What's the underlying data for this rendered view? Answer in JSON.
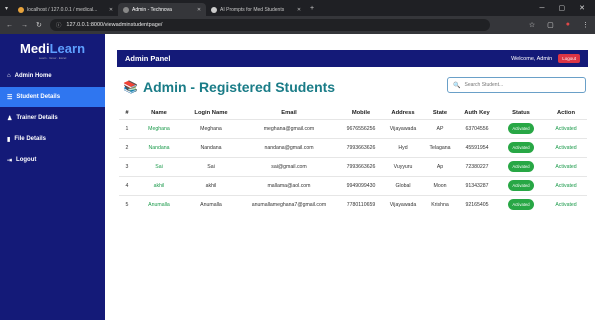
{
  "browser": {
    "tabs": [
      {
        "label": "localhost / 127.0.0.1 / medical...",
        "active": false,
        "color": "#e8a33c"
      },
      {
        "label": "Admin - Technova",
        "active": true,
        "color": "#888888"
      },
      {
        "label": "AI Prompts for Med Students",
        "active": false,
        "color": "#cccccc"
      }
    ],
    "new_tab": "+",
    "url": "127.0.0.1:8000/viewadminstudentpage/"
  },
  "sidebar": {
    "logo_part1": "Medi",
    "logo_part2": "Learn",
    "logo_tagline": "Learn · Grow · Excel",
    "items": [
      {
        "label": "Admin Home",
        "icon": "home-icon"
      },
      {
        "label": "Student Details",
        "icon": "list-icon"
      },
      {
        "label": "Trainer Details",
        "icon": "user-icon"
      },
      {
        "label": "File Details",
        "icon": "file-icon"
      },
      {
        "label": "Logout",
        "icon": "logout-icon"
      }
    ]
  },
  "topbar": {
    "title": "Admin Panel",
    "welcome": "Welcome, Admin",
    "logout": "Logout"
  },
  "page": {
    "heading": "Admin - Registered Students",
    "search_placeholder": "Search Student..."
  },
  "table": {
    "headers": [
      "#",
      "Name",
      "Login Name",
      "Email",
      "Mobile",
      "Address",
      "State",
      "Auth Key",
      "Status",
      "Action"
    ],
    "rows": [
      {
        "num": "1",
        "name": "Meghana",
        "login": "Meghana",
        "email": "meghana@gmail.com",
        "mobile": "9676556256",
        "address": "Vijayawada",
        "state": "AP",
        "authkey": "63704556",
        "status": "Activated",
        "action": "Activated"
      },
      {
        "num": "2",
        "name": "Nandana",
        "login": "Nandana",
        "email": "nandana@gmail.com",
        "mobile": "7993663626",
        "address": "Hyd",
        "state": "Telagana",
        "authkey": "45591954",
        "status": "Activated",
        "action": "Activated"
      },
      {
        "num": "3",
        "name": "Sai",
        "login": "Sai",
        "email": "sai@gmail.com",
        "mobile": "7993663626",
        "address": "Vuyyuru",
        "state": "Ap",
        "authkey": "72380227",
        "status": "Activated",
        "action": "Activated"
      },
      {
        "num": "4",
        "name": "akhil",
        "login": "akhil",
        "email": "mallama@aol.com",
        "mobile": "9949099430",
        "address": "Global",
        "state": "Moon",
        "authkey": "91343287",
        "status": "Activated",
        "action": "Activated"
      },
      {
        "num": "5",
        "name": "Anumalla",
        "login": "Anumalla",
        "email": "anumallameghana7@gmail.com",
        "mobile": "7780110659",
        "address": "Vijayawada",
        "state": "Krishna",
        "authkey": "92165405",
        "status": "Activated",
        "action": "Activated"
      }
    ]
  },
  "colors": {
    "sidebar_bg": "#141a78",
    "active_item": "#2f76f0",
    "heading": "#1a7c87",
    "badge": "#28a745",
    "logout": "#dc3545"
  }
}
